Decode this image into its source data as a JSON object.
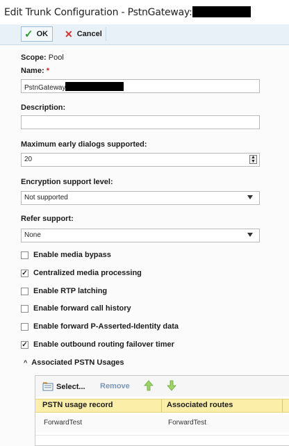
{
  "window": {
    "title": "Edit Trunk Configuration - PstnGateway:"
  },
  "toolbar": {
    "ok_label": "OK",
    "cancel_label": "Cancel"
  },
  "form": {
    "scope_label": "Scope:",
    "scope_value": "Pool",
    "name_label": "Name:",
    "name_required": "*",
    "name_value": "PstnGateway",
    "description_label": "Description:",
    "description_value": "",
    "max_dialogs_label": "Maximum early dialogs supported:",
    "max_dialogs_value": "20",
    "encryption_label": "Encryption support level:",
    "encryption_value": "Not supported",
    "refer_label": "Refer support:",
    "refer_value": "None"
  },
  "checkboxes": [
    {
      "label": "Enable media bypass",
      "checked": false
    },
    {
      "label": "Centralized media processing",
      "checked": true
    },
    {
      "label": "Enable RTP latching",
      "checked": false
    },
    {
      "label": "Enable forward call history",
      "checked": false
    },
    {
      "label": "Enable forward P-Asserted-Identity data",
      "checked": false
    },
    {
      "label": "Enable outbound routing failover timer",
      "checked": true
    }
  ],
  "pstn": {
    "section_label": "Associated PSTN Usages",
    "select_label": "Select...",
    "remove_label": "Remove",
    "columns": [
      "PSTN usage record",
      "Associated routes"
    ],
    "rows": [
      {
        "record": "ForwardTest",
        "routes": "ForwardTest"
      }
    ]
  },
  "colors": {
    "accent": "#e8f1f8",
    "grid_header": "#fbeea9",
    "required": "#d01c1c",
    "ok_green": "#2e9b2e",
    "cancel_red": "#d43030"
  }
}
